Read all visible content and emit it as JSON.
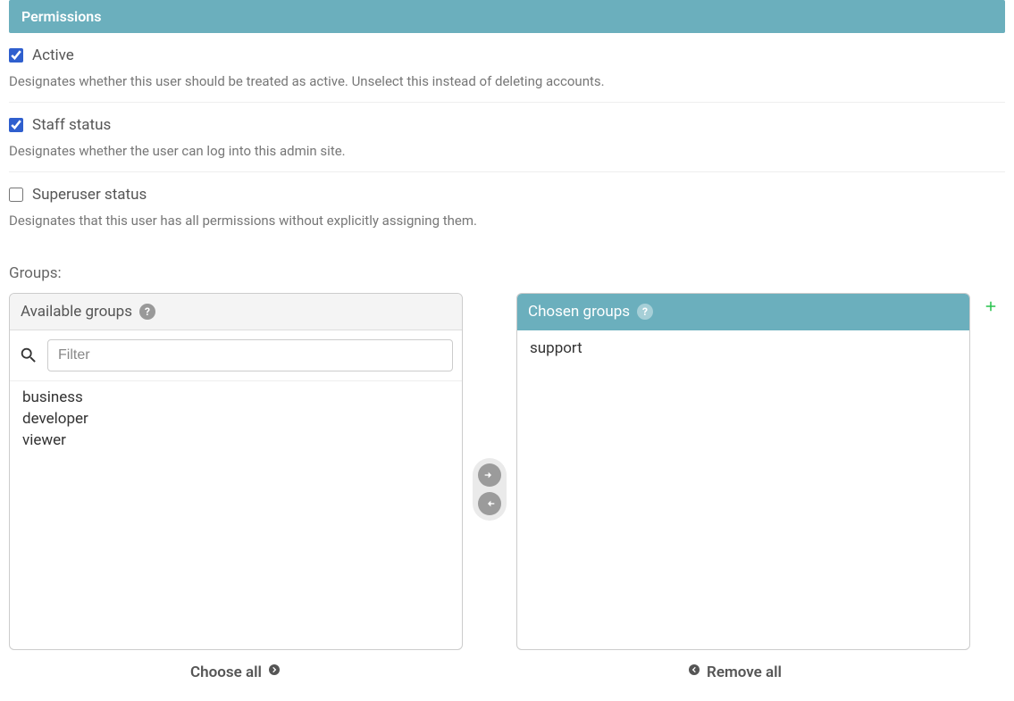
{
  "panel": {
    "title": "Permissions"
  },
  "permissions": {
    "active": {
      "label": "Active",
      "help": "Designates whether this user should be treated as active. Unselect this instead of deleting accounts.",
      "checked": true
    },
    "staff": {
      "label": "Staff status",
      "help": "Designates whether the user can log into this admin site.",
      "checked": true
    },
    "superuser": {
      "label": "Superuser status",
      "help": "Designates that this user has all permissions without explicitly assigning them.",
      "checked": false
    }
  },
  "groups": {
    "section_label": "Groups:",
    "available_header": "Available groups",
    "chosen_header": "Chosen groups",
    "filter_placeholder": "Filter",
    "available_items": [
      "business",
      "developer",
      "viewer"
    ],
    "chosen_items": [
      "support"
    ],
    "choose_all_label": "Choose all",
    "remove_all_label": "Remove all"
  }
}
